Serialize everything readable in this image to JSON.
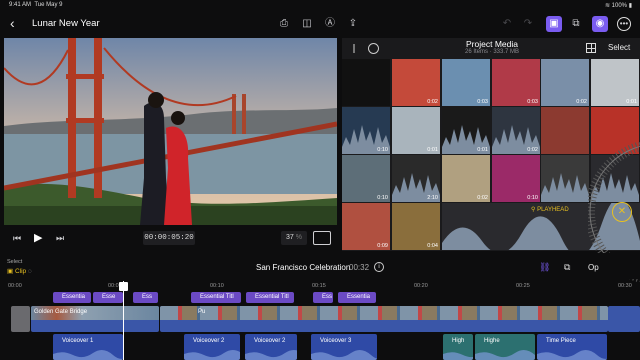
{
  "status": {
    "time": "9:41 AM",
    "date": "Tue May 9",
    "battery": "100%"
  },
  "header": {
    "title": "Lunar New Year"
  },
  "viewer": {
    "timecode": "00:00:05:20",
    "zoom_value": "37",
    "zoom_unit": "%"
  },
  "browser": {
    "title": "Project Media",
    "subtitle": "26 Items · 333.7 MB",
    "select_label": "Select",
    "durations": [
      "",
      "0:02",
      "0:03",
      "0:03",
      "0:02",
      "0:01",
      "0:10",
      "0:01",
      "0:01",
      "0:02",
      "",
      "",
      "0:10",
      "2:10",
      "0:02",
      "0:10",
      "",
      "",
      "0:09",
      "0:04"
    ],
    "playhead_label": "PLAYHEAD"
  },
  "timeline": {
    "select_label": "Select",
    "clip_label": "Clip",
    "project_name": "San Francisco Celebration",
    "project_duration": "00:32",
    "options_label": "Op",
    "ruler": [
      "00:00",
      "00:05",
      "00:10",
      "00:15",
      "00:20",
      "00:25",
      "00:30"
    ],
    "titles": [
      "Essentia",
      "Esse",
      "Ess",
      "Essential Titl",
      "Essential Titl",
      "Ess",
      "Essentia"
    ],
    "video_label": "Golden Gate Bridge",
    "pu_label": "Pu",
    "audio": [
      "Voiceover 1",
      "Voiceover 2",
      "Voiceover 2",
      "Voiceover 3",
      "High",
      "Highe",
      "Time Piece"
    ]
  },
  "colors": {
    "accent": "#7a5cf0",
    "playhead": "#e8c020",
    "title_clip": "#6b4ac4",
    "video_clip": "#3a56a8",
    "audio_clip": "#2f4aa6"
  }
}
